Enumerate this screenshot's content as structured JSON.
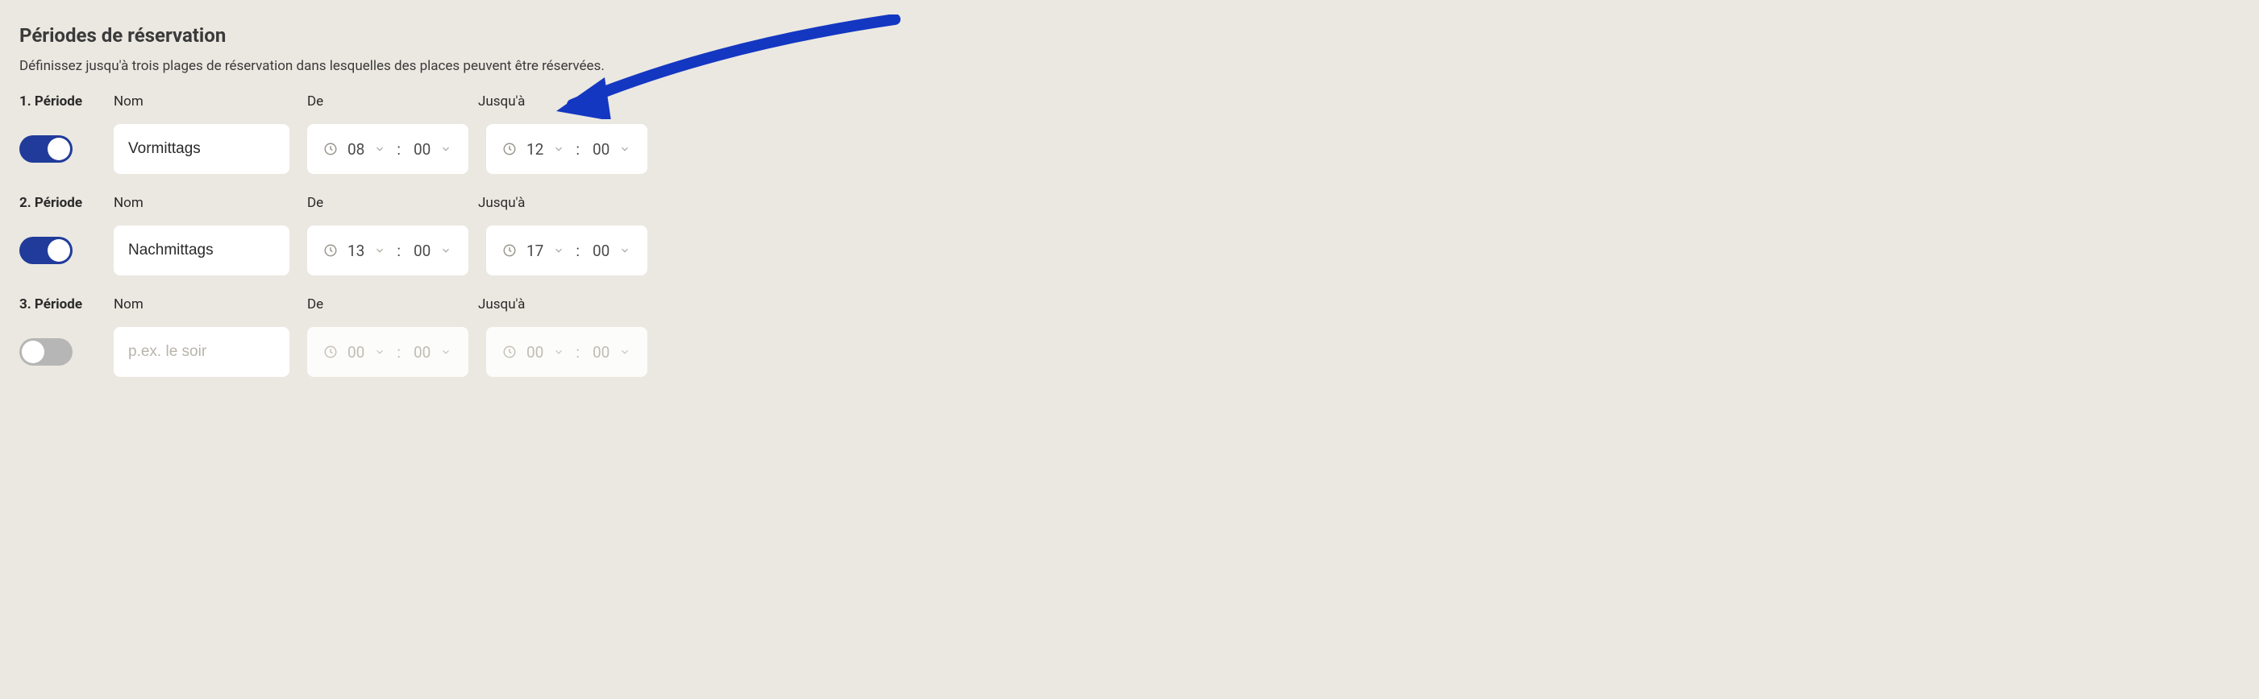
{
  "heading": "Périodes de réservation",
  "description": "Définissez jusqu'à trois plages de réservation dans lesquelles des places peuvent être réservées.",
  "columns": {
    "name": "Nom",
    "from": "De",
    "to": "Jusqu'à"
  },
  "periods": [
    {
      "label": "1. Période",
      "enabled": true,
      "name": "Vormittags",
      "placeholder": "",
      "from": {
        "hh": "08",
        "mm": "00"
      },
      "to": {
        "hh": "12",
        "mm": "00"
      }
    },
    {
      "label": "2. Période",
      "enabled": true,
      "name": "Nachmittags",
      "placeholder": "",
      "from": {
        "hh": "13",
        "mm": "00"
      },
      "to": {
        "hh": "17",
        "mm": "00"
      }
    },
    {
      "label": "3. Période",
      "enabled": false,
      "name": "",
      "placeholder": "p.ex. le soir",
      "from": {
        "hh": "00",
        "mm": "00"
      },
      "to": {
        "hh": "00",
        "mm": "00"
      }
    }
  ],
  "colors": {
    "accent": "#203b9a",
    "arrow": "#1437c2"
  }
}
